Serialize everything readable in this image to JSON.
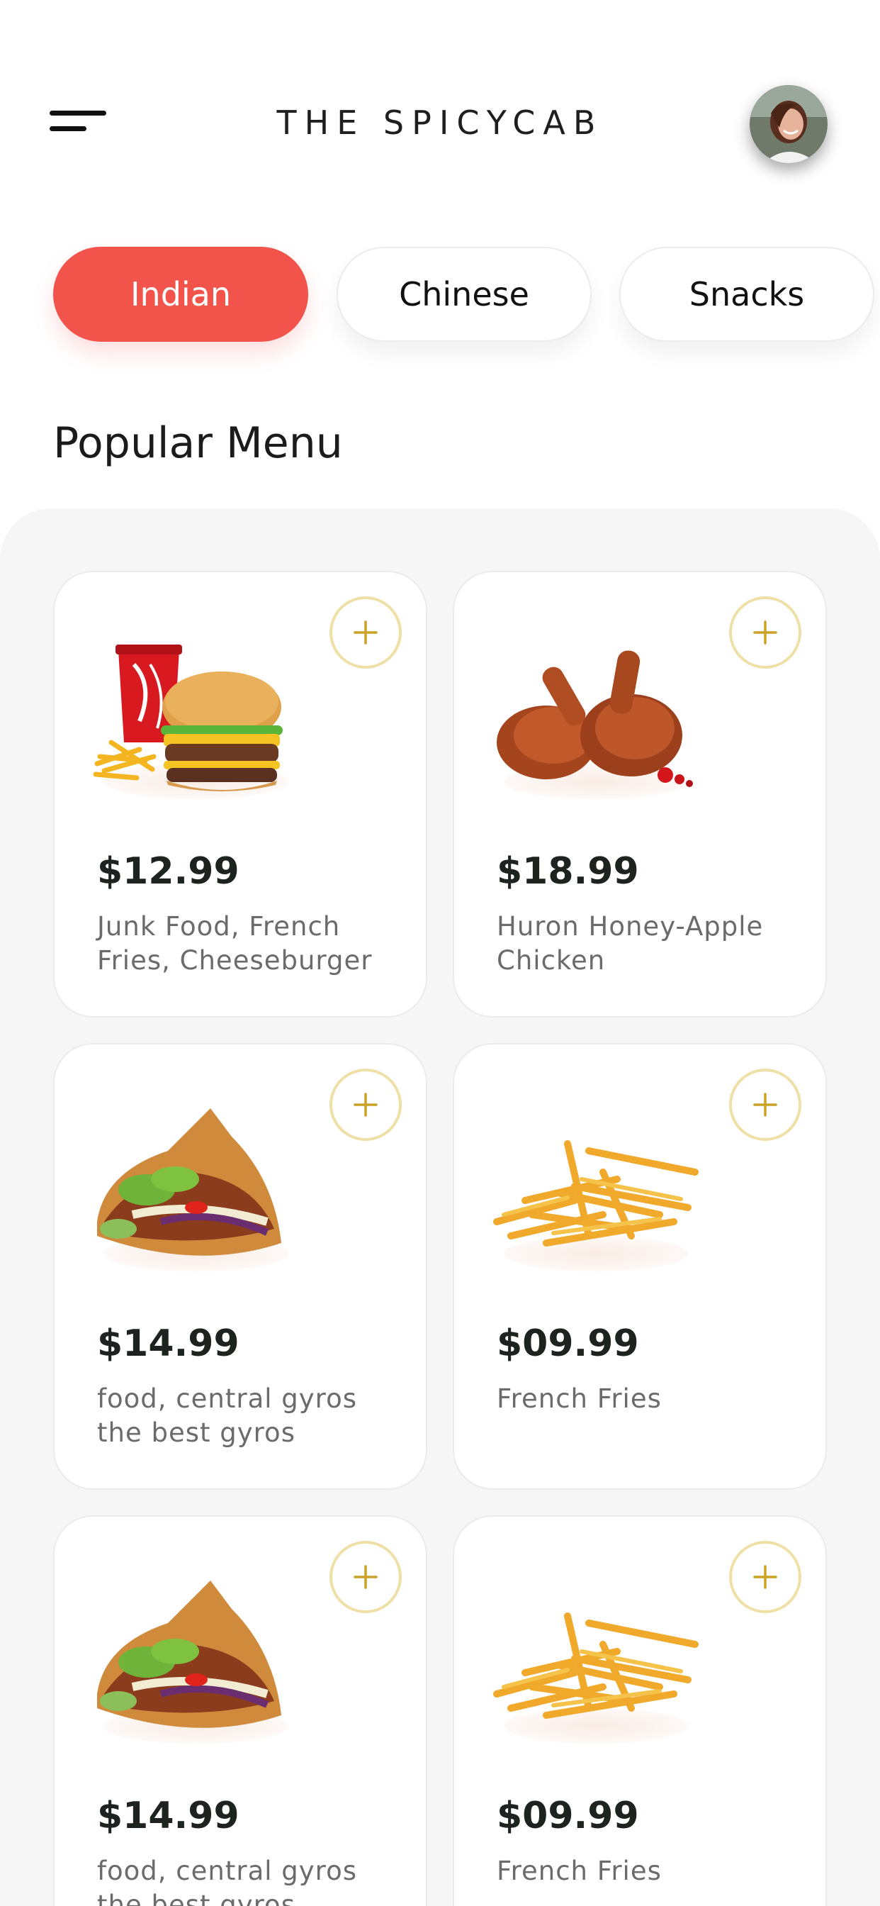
{
  "header": {
    "app_title": "THE SPICYCAB",
    "menu_icon": "hamburger-menu-icon",
    "avatar_icon": "user-avatar"
  },
  "tabs": [
    {
      "label": "Indian",
      "active": true
    },
    {
      "label": "Chinese",
      "active": false
    },
    {
      "label": "Snacks",
      "active": false
    }
  ],
  "section": {
    "title": "Popular Menu"
  },
  "items": [
    {
      "price": "$12.99",
      "description": "Junk Food, French Fries, Cheeseburger",
      "image": "burger-combo-image"
    },
    {
      "price": "$18.99",
      "description": "Huron Honey-Apple Chicken",
      "image": "chicken-legs-image"
    },
    {
      "price": "$14.99",
      "description": "food, central gyros the best gyros",
      "image": "gyros-image"
    },
    {
      "price": "$09.99",
      "description": "French Fries",
      "image": "french-fries-image"
    },
    {
      "price": "$14.99",
      "description": "food, central gyros the best gyros",
      "image": "gyros-image"
    },
    {
      "price": "$09.99",
      "description": "French Fries",
      "image": "french-fries-image"
    }
  ],
  "colors": {
    "accent": "#f2534b",
    "add_button_ring": "#efe0a8",
    "add_button_plus": "#c9a227",
    "panel_background": "#f6f6f6"
  }
}
